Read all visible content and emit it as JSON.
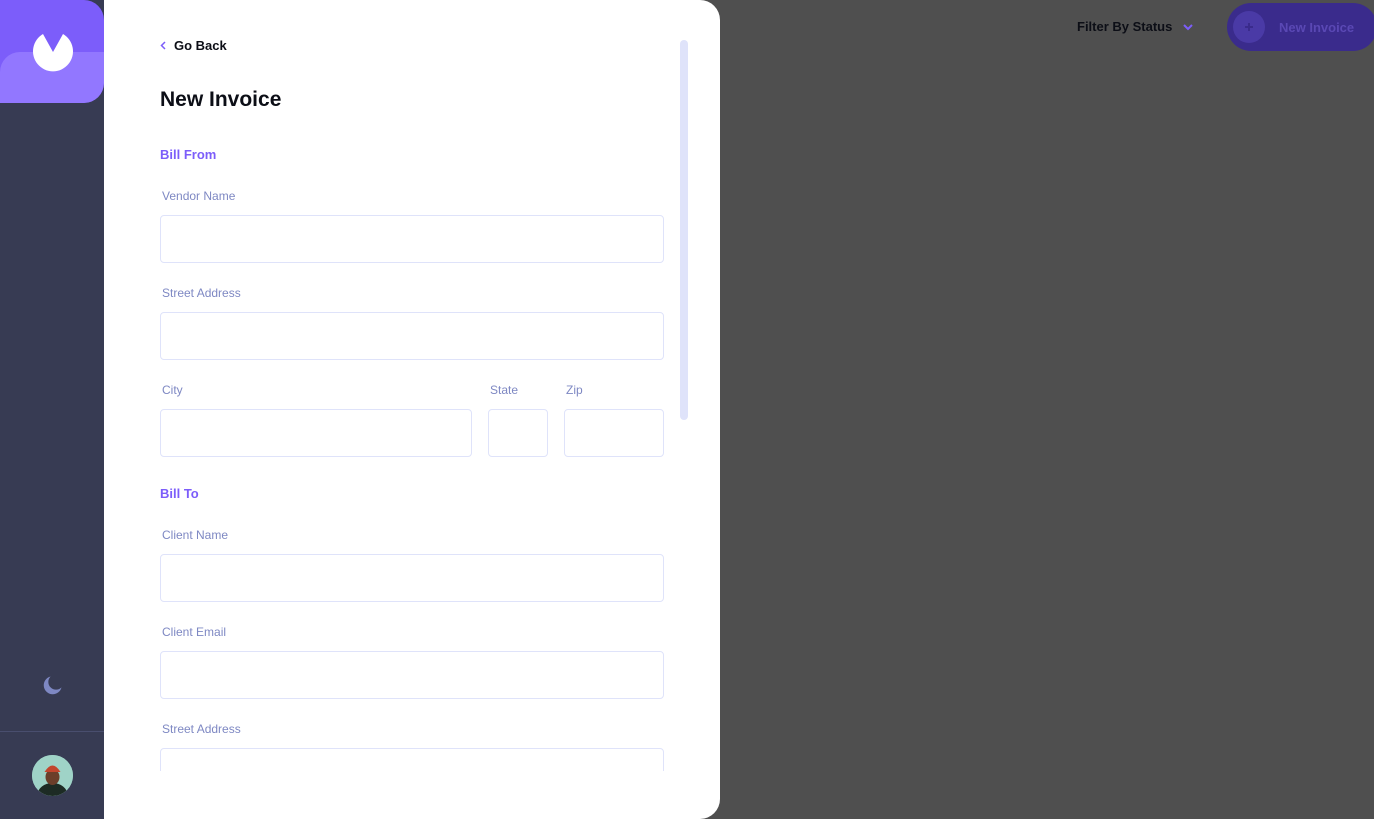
{
  "header": {
    "filter_label": "Filter By Status",
    "new_invoice_label": "New Invoice"
  },
  "sidebar": {
    "logo_icon": "logo-icon",
    "theme_icon": "moon-icon",
    "avatar": "avatar"
  },
  "form": {
    "go_back_label": "Go Back",
    "title": "New Invoice",
    "bill_from": {
      "heading": "Bill From",
      "vendor_name_label": "Vendor Name",
      "vendor_name_value": "",
      "street_label": "Street Address",
      "street_value": "",
      "city_label": "City",
      "city_value": "",
      "state_label": "State",
      "state_value": "",
      "zip_label": "Zip",
      "zip_value": ""
    },
    "bill_to": {
      "heading": "Bill To",
      "client_name_label": "Client Name",
      "client_name_value": "",
      "client_email_label": "Client Email",
      "client_email_value": "",
      "street_label": "Street Address",
      "street_value": ""
    }
  },
  "colors": {
    "accent": "#7c5dfa",
    "sidebar": "#373b53",
    "label": "#7e88c3",
    "overlay": "#4f4f4f"
  }
}
